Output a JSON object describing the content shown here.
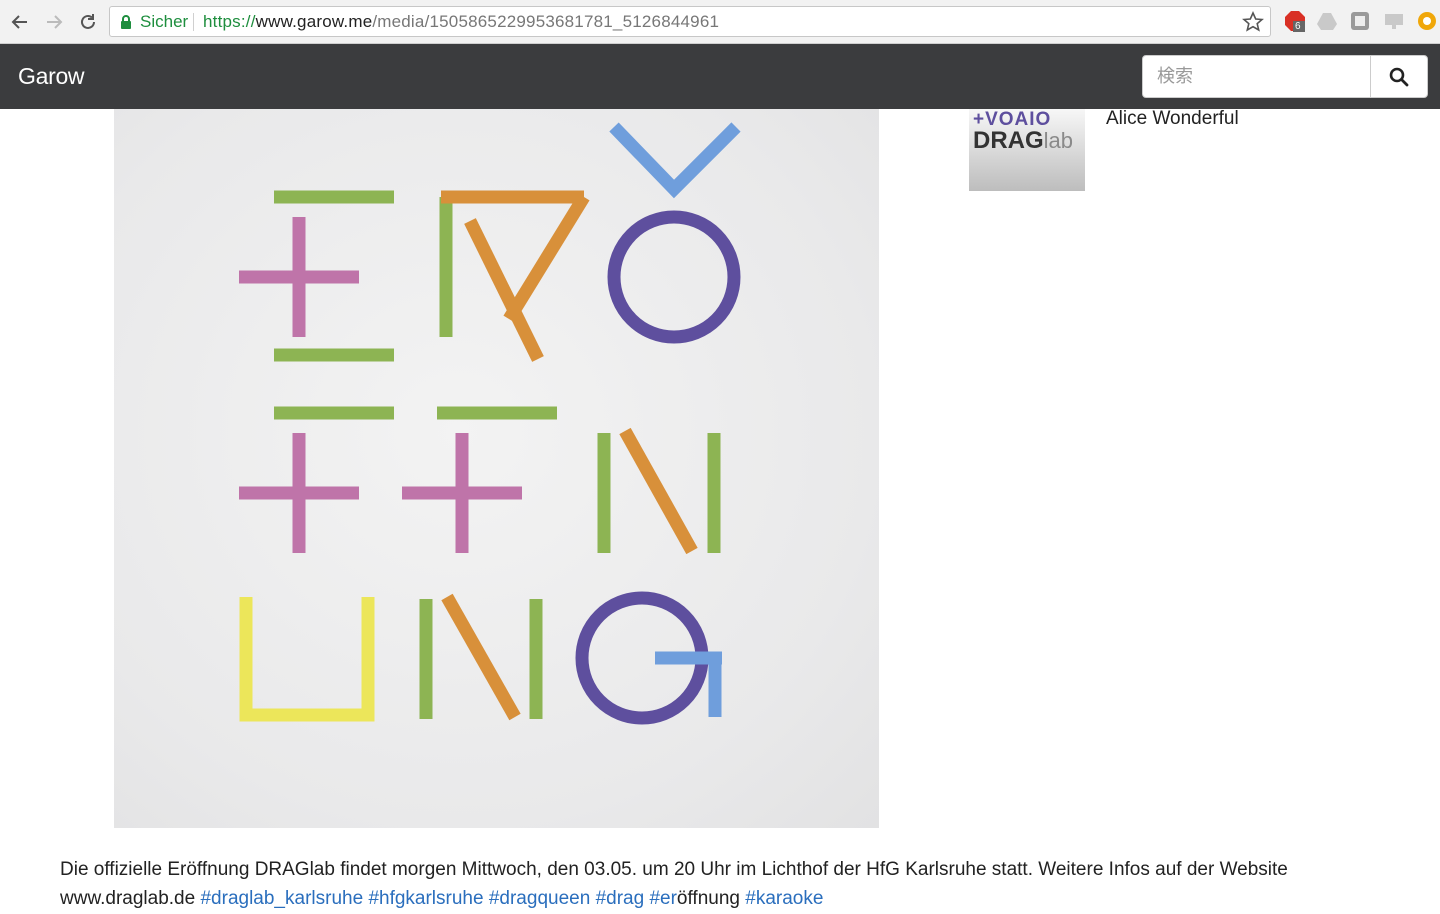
{
  "browser": {
    "security_label": "Sicher",
    "url_scheme": "https://",
    "url_host": "www.garow.me",
    "url_path": "/media/1505865229953681781_5126844961",
    "extension_badge": "6"
  },
  "navbar": {
    "brand": "Garow",
    "search_placeholder": "検索"
  },
  "post": {
    "author_name": "Alice Wonderful",
    "avatar_text_top": "+VOAIO",
    "avatar_text_drag": "DRAG",
    "avatar_text_lab": "lab",
    "caption_text": "Die offizielle Eröffnung DRAGlab findet morgen Mittwoch, den 03.05. um 20 Uhr im Lichthof der HfG Karlsruhe statt. Weitere Infos auf der Website www.draglab.de",
    "hashtags": [
      "#draglab_karlsruhe",
      "#hfgkarlsruhe",
      "#dragqueen",
      "#drag",
      "#er"
    ],
    "hashtag_trailing_text": "öffnung",
    "last_hashtag": "#karaoke"
  },
  "colors": {
    "navbar_bg": "#3b3c3e",
    "link": "#2a6ebd",
    "secure_green": "#1e8e3e",
    "letter_green": "#8db453",
    "letter_pink": "#bf74a9",
    "letter_orange": "#d8903a",
    "letter_purple": "#5e4f9e",
    "letter_blue": "#6f9edc",
    "letter_yellow": "#ece65a"
  }
}
